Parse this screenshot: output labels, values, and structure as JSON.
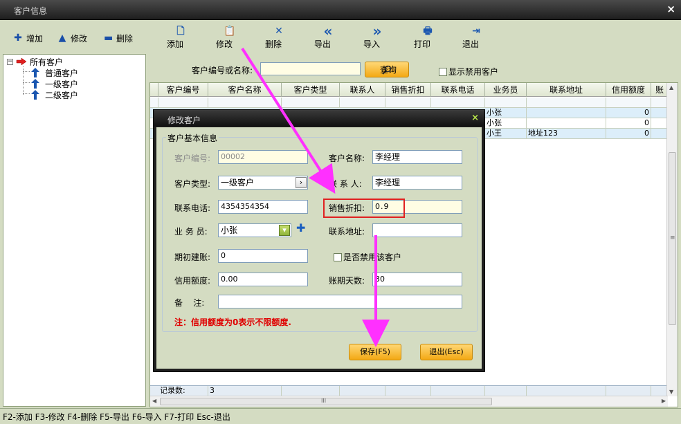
{
  "window": {
    "title": "客户信息",
    "close_glyph": "×"
  },
  "toolbar_left": [
    {
      "label": "增加",
      "icon": "plus-icon",
      "glyph": "✚"
    },
    {
      "label": "修改",
      "icon": "triangle-up-icon",
      "glyph": "▲"
    },
    {
      "label": "删除",
      "icon": "minus-icon",
      "glyph": "▬"
    }
  ],
  "toolbar_main": [
    {
      "label": "添加",
      "icon": "new-document-icon",
      "glyph": "🗋"
    },
    {
      "label": "修改",
      "icon": "edit-document-icon",
      "glyph": "📋"
    },
    {
      "label": "删除",
      "icon": "delete-x-icon",
      "glyph": "✕"
    },
    {
      "label": "导出",
      "icon": "double-left-arrow-icon",
      "glyph": "«"
    },
    {
      "label": "导入",
      "icon": "double-right-arrow-icon",
      "glyph": "»"
    },
    {
      "label": "打印",
      "icon": "printer-icon",
      "glyph": "🖶"
    },
    {
      "label": "退出",
      "icon": "exit-door-icon",
      "glyph": "⇥"
    }
  ],
  "tree": {
    "root": "所有客户",
    "children": [
      "普通客户",
      "一级客户",
      "二级客户"
    ],
    "expander": "−"
  },
  "search": {
    "label": "客户编号或名称:",
    "value": "",
    "button": "查询",
    "show_disabled": "显示禁用客户"
  },
  "grid": {
    "columns": [
      "客户编号",
      "客户名称",
      "客户类型",
      "联系人",
      "销售折扣",
      "联系电话",
      "业务员",
      "联系地址",
      "信用额度",
      "账"
    ],
    "rows": [
      {
        "salesman": "",
        "address": "",
        "credit": ""
      },
      {
        "salesman": "小张",
        "address": "",
        "credit": "0"
      },
      {
        "salesman": "小张",
        "address": "",
        "credit": "0"
      },
      {
        "salesman": "小王",
        "address": "地址123",
        "credit": "0"
      }
    ],
    "record_label": "记录数:",
    "record_count": "3",
    "hscroll_grip": "III",
    "vscroll_grip": "≡"
  },
  "status": "F2-添加 F3-修改 F4-删除 F5-导出 F6-导入 F7-打印 Esc-退出",
  "dialog": {
    "title": "修改客户",
    "close_glyph": "×",
    "group": "客户基本信息",
    "fields": {
      "code_label": "客户编号:",
      "code_value": "00002",
      "name_label": "客户名称:",
      "name_value": "李经理",
      "type_label": "客户类型:",
      "type_value": "一级客户",
      "contact_label": "联 系 人:",
      "contact_value": "李经理",
      "phone_label": "联系电话:",
      "phone_value": "4354354354",
      "discount_label": "销售折扣:",
      "discount_value": "0.9",
      "salesman_label": "业 务 员:",
      "salesman_value": "小张",
      "address_label": "联系地址:",
      "address_value": "",
      "opening_label": "期初建账:",
      "opening_value": "0",
      "disable_label": "是否禁用该客户",
      "credit_label": "信用额度:",
      "credit_value": "0.00",
      "days_label": "账期天数:",
      "days_value": "30",
      "remark_label": "备    注:",
      "remark_value": ""
    },
    "note": "注：信用额度为0表示不限额度.",
    "save": "保存(F5)",
    "exit": "退出(Esc)"
  },
  "colors": {
    "accent_orange": "#f3a914",
    "annotation_magenta": "#ff30ff",
    "highlight_red": "#e02020"
  }
}
